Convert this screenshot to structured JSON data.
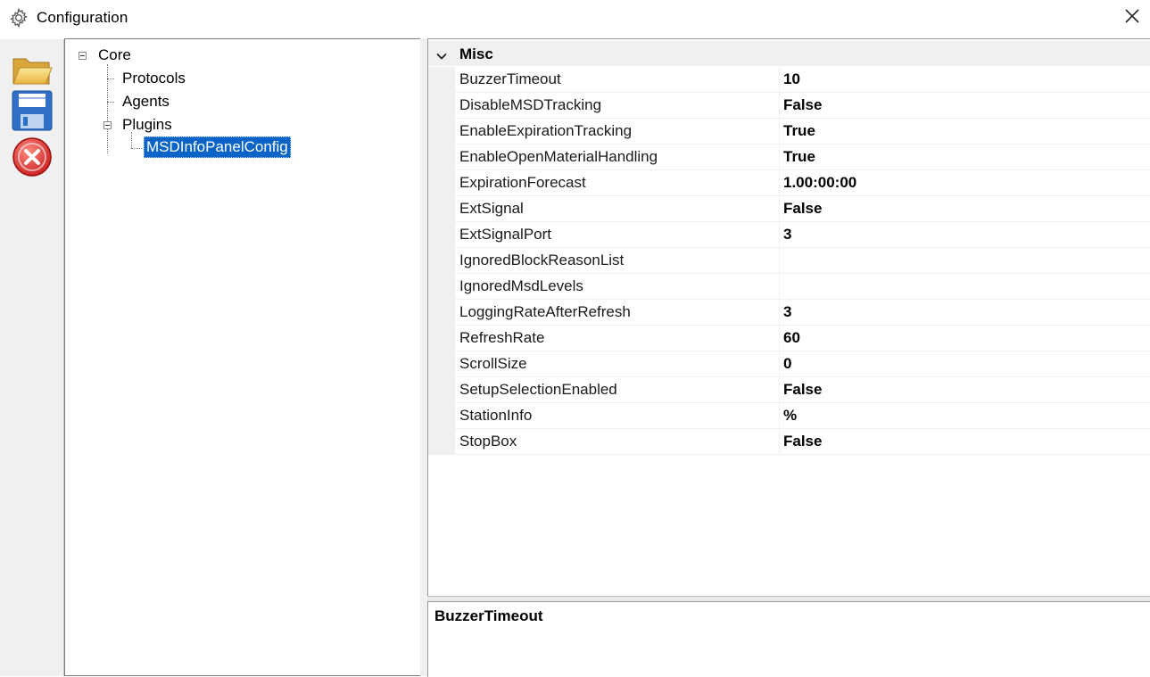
{
  "window": {
    "title": "Configuration",
    "icon": "gear-icon",
    "close_icon": "close-icon"
  },
  "toolbar": {
    "items": [
      {
        "name": "open",
        "icon": "folder-open-icon"
      },
      {
        "name": "save",
        "icon": "floppy-disk-icon"
      },
      {
        "name": "cancel",
        "icon": "red-x-circle-icon"
      }
    ]
  },
  "tree": {
    "root": "Core",
    "children": [
      "Protocols",
      "Agents",
      "Plugins"
    ],
    "plugins_children": [
      "MSDInfoPanelConfig"
    ],
    "selected": "MSDInfoPanelConfig"
  },
  "grid": {
    "category": "Misc",
    "properties": [
      {
        "name": "BuzzerTimeout",
        "value": "10"
      },
      {
        "name": "DisableMSDTracking",
        "value": "False"
      },
      {
        "name": "EnableExpirationTracking",
        "value": "True"
      },
      {
        "name": "EnableOpenMaterialHandling",
        "value": "True"
      },
      {
        "name": "ExpirationForecast",
        "value": "1.00:00:00"
      },
      {
        "name": "ExtSignal",
        "value": "False"
      },
      {
        "name": "ExtSignalPort",
        "value": "3"
      },
      {
        "name": "IgnoredBlockReasonList",
        "value": ""
      },
      {
        "name": "IgnoredMsdLevels",
        "value": ""
      },
      {
        "name": "LoggingRateAfterRefresh",
        "value": "3"
      },
      {
        "name": "RefreshRate",
        "value": "60"
      },
      {
        "name": "ScrollSize",
        "value": "0"
      },
      {
        "name": "SetupSelectionEnabled",
        "value": "False"
      },
      {
        "name": "StationInfo",
        "value": "%"
      },
      {
        "name": "StopBox",
        "value": "False"
      }
    ]
  },
  "help": {
    "title": "BuzzerTimeout"
  }
}
